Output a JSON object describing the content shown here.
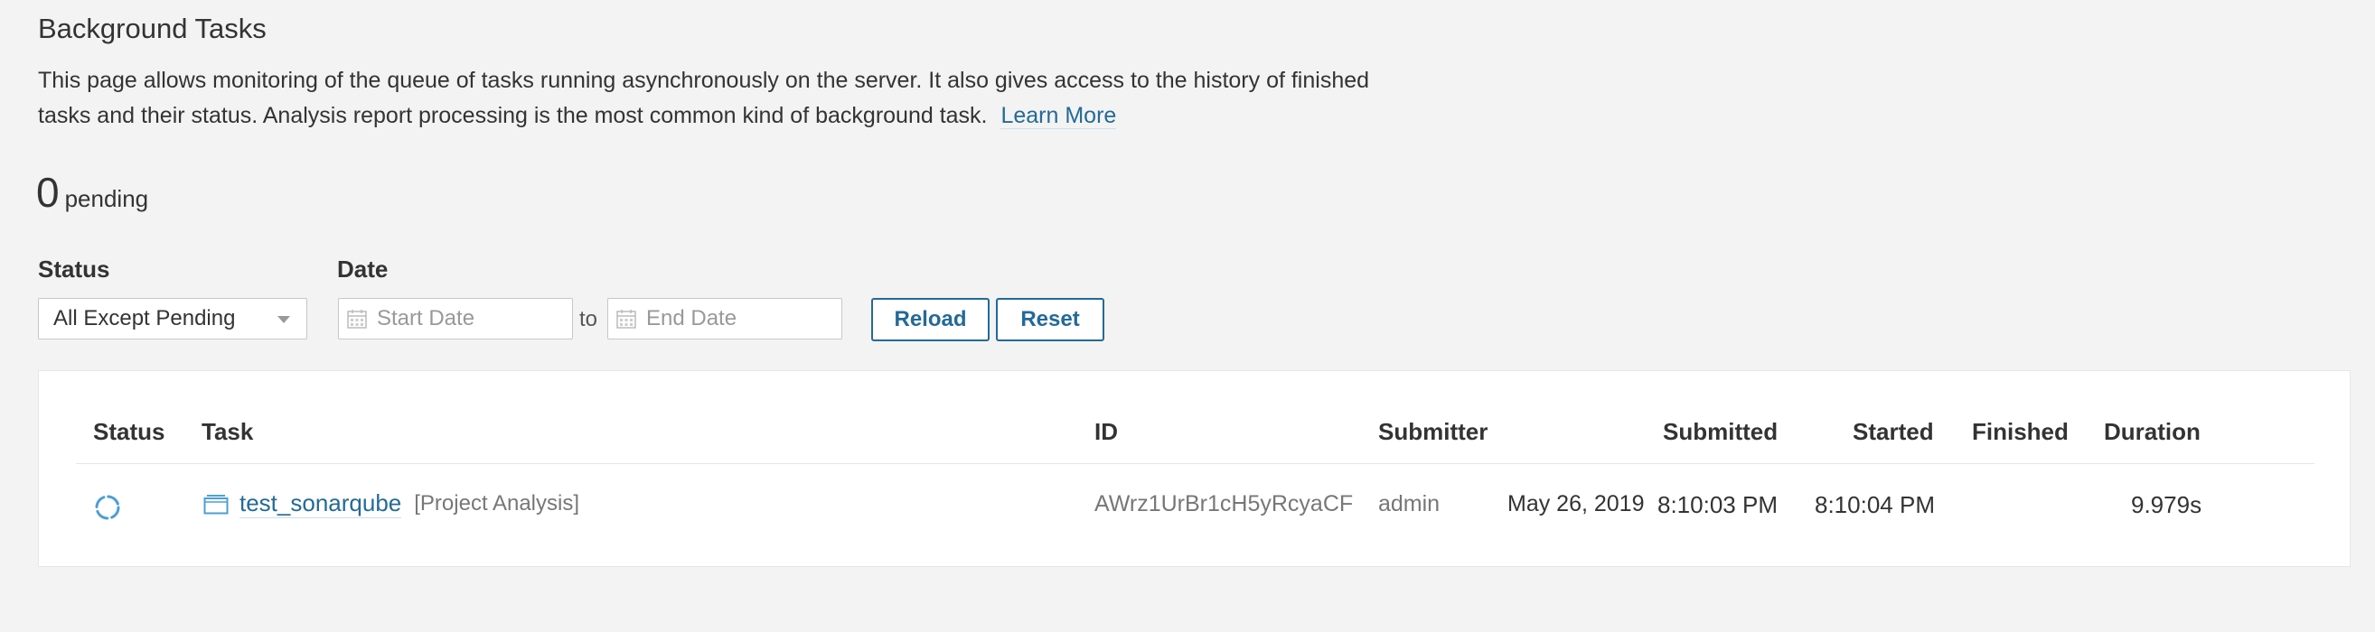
{
  "page": {
    "title": "Background Tasks",
    "description_line1": "This page allows monitoring of the queue of tasks running asynchronously on the server. It also gives access to the history of finished",
    "description_line2": "tasks and their status. Analysis report processing is the most common kind of background task.",
    "learn_more": "Learn More"
  },
  "pending": {
    "count": "0",
    "label": "pending"
  },
  "filters": {
    "status_label": "Status",
    "status_value": "All Except Pending",
    "date_label": "Date",
    "start_placeholder": "Start Date",
    "to_label": "to",
    "end_placeholder": "End Date",
    "reload_label": "Reload",
    "reset_label": "Reset"
  },
  "table": {
    "headers": {
      "status": "Status",
      "task": "Task",
      "id": "ID",
      "submitter": "Submitter",
      "submitted": "Submitted",
      "started": "Started",
      "finished": "Finished",
      "duration": "Duration"
    },
    "rows": [
      {
        "status_icon": "spinner-icon",
        "task_name": "test_sonarqube",
        "task_type": "[Project Analysis]",
        "id": "AWrz1UrBr1cH5yRcyaCF",
        "submitter": "admin",
        "submitted_date": "May 26, 2019",
        "submitted_time": "8:10:03 PM",
        "started": "8:10:04 PM",
        "finished": "",
        "duration": "9.979s"
      }
    ]
  },
  "colors": {
    "link": "#236a97",
    "spinner": "#4b9fd5",
    "background": "#f3f3f3"
  }
}
